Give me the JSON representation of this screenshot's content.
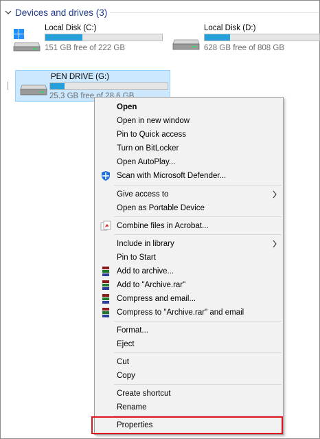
{
  "section": {
    "title": "Devices and drives (3)"
  },
  "drives": [
    {
      "name": "Local Disk (C:)",
      "free": "151 GB free of 222 GB",
      "used_fraction": 0.32
    },
    {
      "name": "Local Disk (D:)",
      "free": "628 GB free of 808 GB",
      "used_fraction": 0.22
    },
    {
      "name": "PEN DRIVE (G:)",
      "free": "25.3 GB free of 28.6 GB",
      "used_fraction": 0.12
    }
  ],
  "context_menu": {
    "open": "Open",
    "open_new_window": "Open in new window",
    "pin_quick_access": "Pin to Quick access",
    "turn_on_bitlocker": "Turn on BitLocker",
    "open_autoplay": "Open AutoPlay...",
    "scan_defender": "Scan with Microsoft Defender...",
    "give_access": "Give access to",
    "open_portable": "Open as Portable Device",
    "combine_acrobat": "Combine files in Acrobat...",
    "include_library": "Include in library",
    "pin_start": "Pin to Start",
    "add_archive": "Add to archive...",
    "add_archive_rar": "Add to \"Archive.rar\"",
    "compress_email": "Compress and email...",
    "compress_rar_email": "Compress to \"Archive.rar\" and email",
    "format": "Format...",
    "eject": "Eject",
    "cut": "Cut",
    "copy": "Copy",
    "create_shortcut": "Create shortcut",
    "rename": "Rename",
    "properties": "Properties"
  },
  "colors": {
    "accent": "#26a0da",
    "selection": "#cce8ff",
    "highlight": "#e0141e"
  }
}
